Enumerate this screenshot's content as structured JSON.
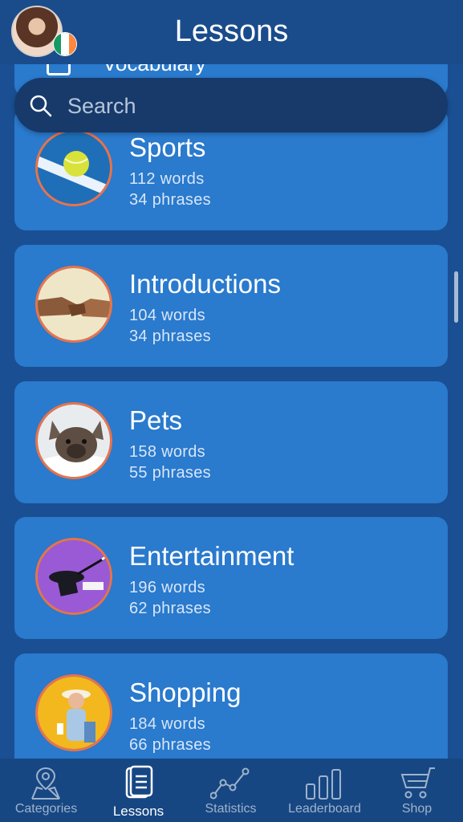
{
  "header": {
    "title": "Lessons"
  },
  "partial_card": {
    "label": "Vocabulary"
  },
  "search": {
    "placeholder": "Search"
  },
  "lessons": [
    {
      "title": "Sports",
      "words": "112 words",
      "phrases": "34 phrases"
    },
    {
      "title": "Introductions",
      "words": "104 words",
      "phrases": "34 phrases"
    },
    {
      "title": "Pets",
      "words": "158 words",
      "phrases": "55 phrases"
    },
    {
      "title": "Entertainment",
      "words": "196 words",
      "phrases": "62 phrases"
    },
    {
      "title": "Shopping",
      "words": "184 words",
      "phrases": "66 phrases"
    }
  ],
  "tabs": [
    {
      "label": "Categories",
      "icon": "map-icon"
    },
    {
      "label": "Lessons",
      "icon": "book-icon"
    },
    {
      "label": "Statistics",
      "icon": "chart-icon"
    },
    {
      "label": "Leaderboard",
      "icon": "bars-icon"
    },
    {
      "label": "Shop",
      "icon": "cart-icon"
    }
  ],
  "colors": {
    "background": "#1a4f93",
    "card": "#2a7acd",
    "search_bg": "#173a6b",
    "tabbar": "#174783",
    "accent_ring": "#e8734a"
  }
}
